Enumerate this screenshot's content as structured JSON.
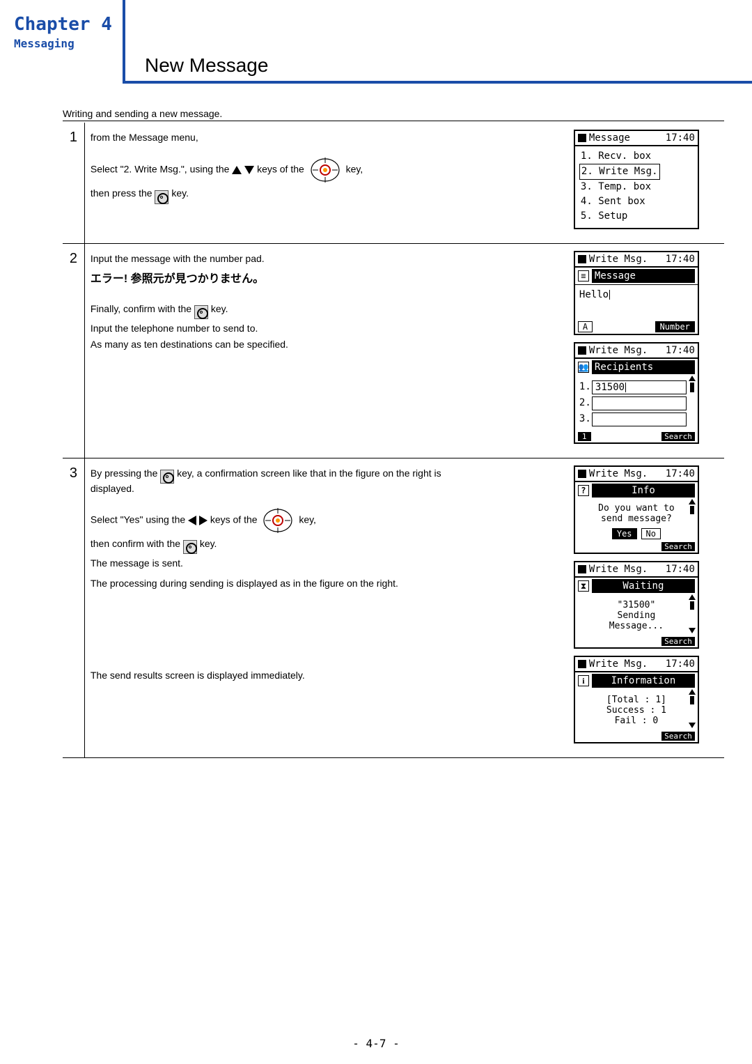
{
  "chapter": {
    "title": "Chapter 4",
    "subtitle": "Messaging"
  },
  "page_title": "New Message",
  "intro": "Writing and sending a new message.",
  "steps": {
    "s1": {
      "num": "1",
      "l1": "from the Message menu,",
      "l2a": "Select \"2. Write Msg.\", using the",
      "l2b": "keys of the",
      "l2c": "key,",
      "l3a": "then press the",
      "l3b": "key."
    },
    "s2": {
      "num": "2",
      "l1": "Input the message with the number pad.",
      "jp": "エラー! 参照元が見つかりません。",
      "l2a": "Finally, confirm with the",
      "l2b": "key.",
      "l3": "Input the telephone number to send to.",
      "l4": "As many as ten destinations can be specified."
    },
    "s3": {
      "num": "3",
      "l1a": "By pressing the",
      "l1b": "key, a confirmation screen like that in the figure on the right is",
      "l1c": "displayed.",
      "l2a": "Select \"Yes\" using the",
      "l2b": "keys of the",
      "l2c": "key,",
      "l3a": "then confirm with the",
      "l3b": "key.",
      "l4": "The message is sent.",
      "l5": "The processing during sending is displayed as in the figure on the right.",
      "l6": "The send results screen is displayed immediately."
    }
  },
  "screens": {
    "message_menu": {
      "title": "Message",
      "time": "17:40",
      "items": [
        "1. Recv. box",
        "2. Write Msg.",
        "3. Temp. box",
        "4. Sent box",
        "5. Setup"
      ]
    },
    "write_msg_input": {
      "title": "Write Msg.",
      "time": "17:40",
      "bar": "Message",
      "content": "Hello",
      "soft_left": "A",
      "soft_right": "Number"
    },
    "recipients": {
      "title": "Write Msg.",
      "time": "17:40",
      "bar": "Recipients",
      "rows": {
        "r1": "31500",
        "r2": "",
        "r3": ""
      },
      "foot_left": "1",
      "foot_right": "Search"
    },
    "confirm": {
      "title": "Write Msg.",
      "time": "17:40",
      "bar": "Info",
      "msg1": "Do you want to",
      "msg2": "send message?",
      "yes": "Yes",
      "no": "No",
      "foot_right": "Search"
    },
    "waiting": {
      "title": "Write Msg.",
      "time": "17:40",
      "bar": "Waiting",
      "l1": "\"31500\"",
      "l2": "Sending",
      "l3": "Message...",
      "foot_right": "Search"
    },
    "result": {
      "title": "Write Msg.",
      "time": "17:40",
      "bar": "Information",
      "l1": "[Total : 1]",
      "l2": "Success : 1",
      "l3": "Fail : 0",
      "foot_right": "Search"
    }
  },
  "footer": "- 4-7 -"
}
